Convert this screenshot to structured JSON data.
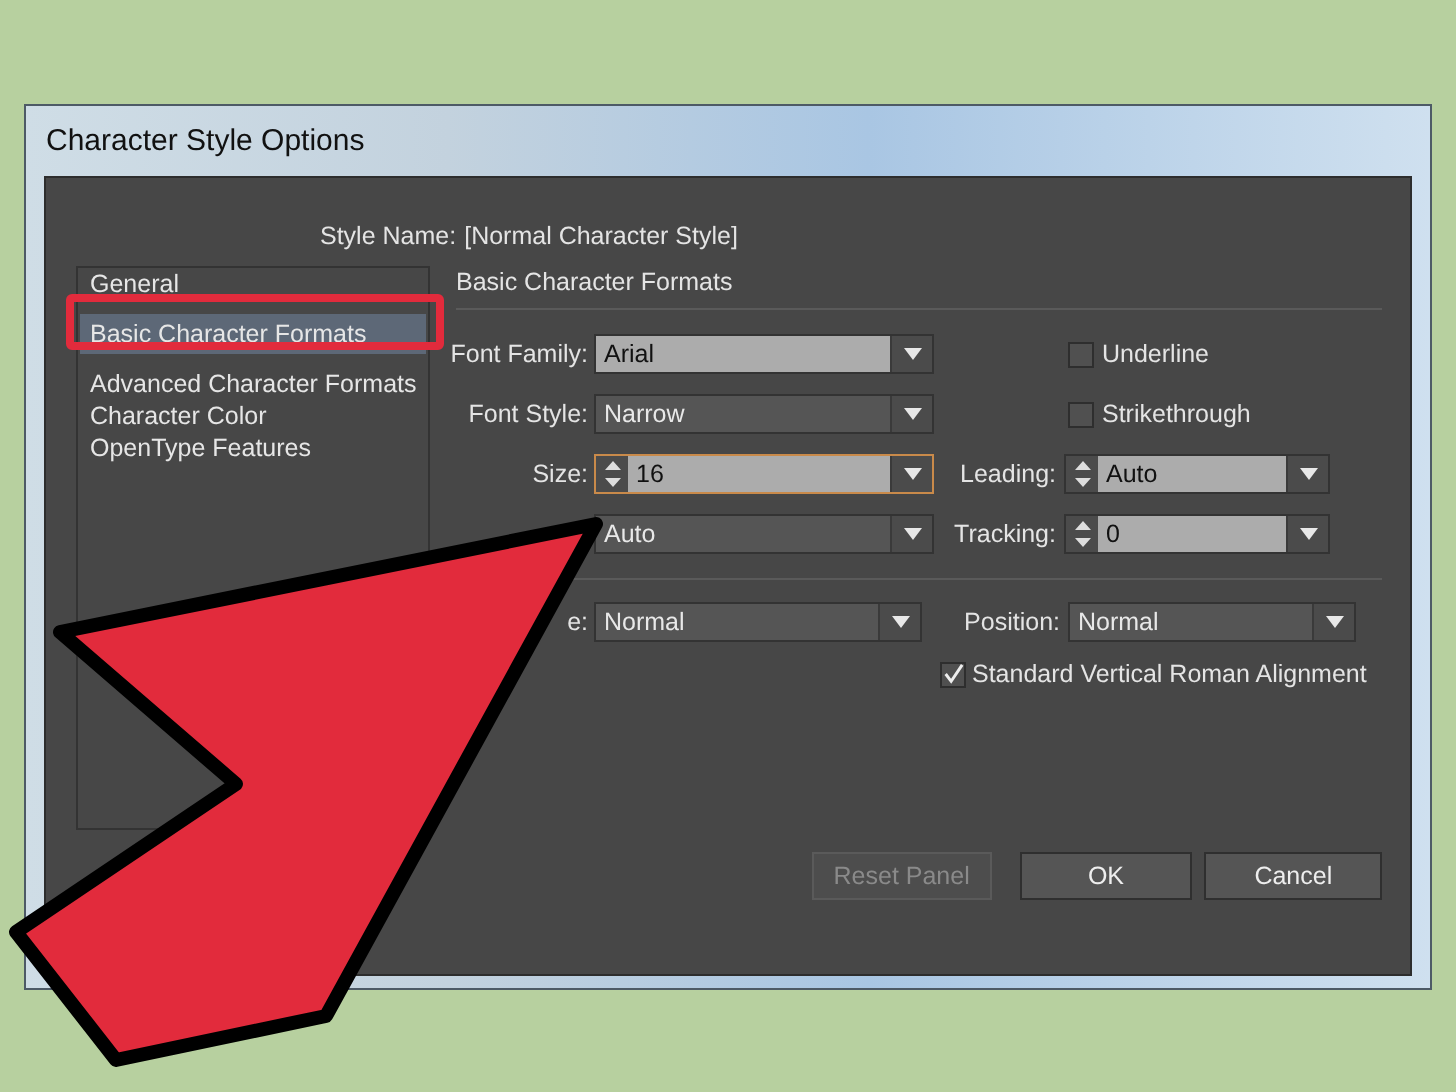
{
  "window": {
    "title": "Character Style Options"
  },
  "style_name": {
    "label": "Style Name:",
    "value": "[Normal Character Style]"
  },
  "sidebar": {
    "items": [
      {
        "label": "General",
        "selected": false
      },
      {
        "label": "Basic Character Formats",
        "selected": true
      },
      {
        "label": "Advanced Character Formats",
        "selected": false
      },
      {
        "label": "Character Color",
        "selected": false
      },
      {
        "label": "OpenType Features",
        "selected": false
      }
    ]
  },
  "section_title": "Basic Character Formats",
  "rows": [
    {
      "left": {
        "kind": "dropdown",
        "label": "Font Family:",
        "value": "Arial",
        "editable": true,
        "focused": false
      },
      "right": {
        "kind": "checkbox",
        "label": "Underline",
        "checked": false
      }
    },
    {
      "left": {
        "kind": "dropdown",
        "label": "Font Style:",
        "value": "Narrow",
        "editable": false,
        "focused": false
      },
      "right": {
        "kind": "checkbox",
        "label": "Strikethrough",
        "checked": false
      }
    },
    {
      "left": {
        "kind": "spin",
        "label": "Size:",
        "value": "16",
        "editable": true,
        "focused": true
      },
      "right": {
        "kind": "spin",
        "label": "Leading:",
        "value": "Auto",
        "editable": true,
        "focused": false
      }
    },
    {
      "left": {
        "kind": "dropdown",
        "value": "Auto",
        "editable": false,
        "focused": false
      },
      "right": {
        "kind": "spin",
        "label": "Tracking:",
        "value": "0",
        "editable": true,
        "focused": false
      }
    }
  ],
  "lower": {
    "case": {
      "label": "e:",
      "value": "Normal"
    },
    "position": {
      "label": "Position:",
      "value": "Normal"
    },
    "alignment": {
      "label": "Standard Vertical Roman Alignment",
      "checked": true
    }
  },
  "buttons": [
    {
      "label": "Reset Panel",
      "disabled": true
    },
    {
      "label": "OK",
      "disabled": false
    },
    {
      "label": "Cancel",
      "disabled": false
    }
  ]
}
